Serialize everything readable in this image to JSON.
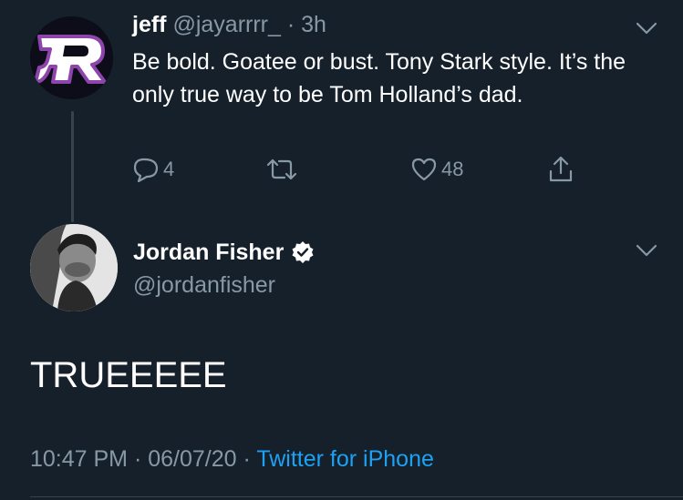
{
  "reply_to_tweet": {
    "display_name": "jeff",
    "handle": "@jayarrrr_",
    "separator": "·",
    "time": "3h",
    "avatar_text": "JR",
    "text": "Be bold. Goatee or bust. Tony Stark style. It’s the only true way to be Tom Holland’s dad.",
    "reply_count": "4",
    "like_count": "48",
    "icons": [
      "reply-icon",
      "retweet-icon",
      "like-icon",
      "share-icon",
      "chevron-down-icon"
    ]
  },
  "main_tweet": {
    "display_name": "Jordan Fisher",
    "handle": "@jordanfisher",
    "text": "TRUEEEEE",
    "time": "10:47 PM",
    "separator": "·",
    "date": "06/07/20",
    "separator2": "·",
    "source": "Twitter for iPhone",
    "icons": [
      "verified-badge-icon",
      "chevron-down-icon"
    ]
  },
  "colors": {
    "background": "#15202b",
    "secondary_text": "#8899a6",
    "link": "#1da1f2",
    "divider": "#38444d",
    "avatar_accent": "#8e44ad"
  }
}
